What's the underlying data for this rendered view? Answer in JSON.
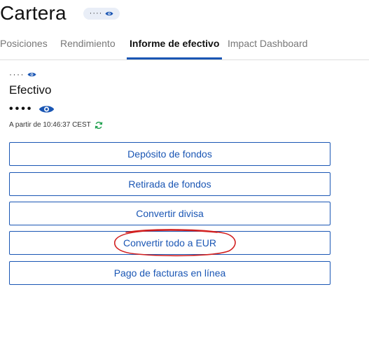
{
  "header": {
    "title": "Cartera",
    "masked_value": "····"
  },
  "tabs": [
    {
      "label": "Posiciones",
      "active": false
    },
    {
      "label": "Rendimiento",
      "active": false
    },
    {
      "label": "Informe de efectivo",
      "active": true
    },
    {
      "label": "Impact Dashboard",
      "active": false
    }
  ],
  "cash": {
    "masked_small": "····",
    "title": "Efectivo",
    "masked_balance": "••••",
    "timestamp": "A partir de 10:46:37 CEST"
  },
  "actions": [
    {
      "label": "Depósito de fondos"
    },
    {
      "label": "Retirada de fondos"
    },
    {
      "label": "Convertir divisa"
    },
    {
      "label": "Convertir todo a EUR",
      "highlighted": true
    },
    {
      "label": "Pago de facturas en línea"
    }
  ],
  "colors": {
    "accent": "#1a56b4",
    "annotation": "#d21f1f",
    "refresh": "#1a9e4a"
  },
  "icons": {
    "eye": "eye-icon",
    "refresh": "refresh-icon"
  }
}
